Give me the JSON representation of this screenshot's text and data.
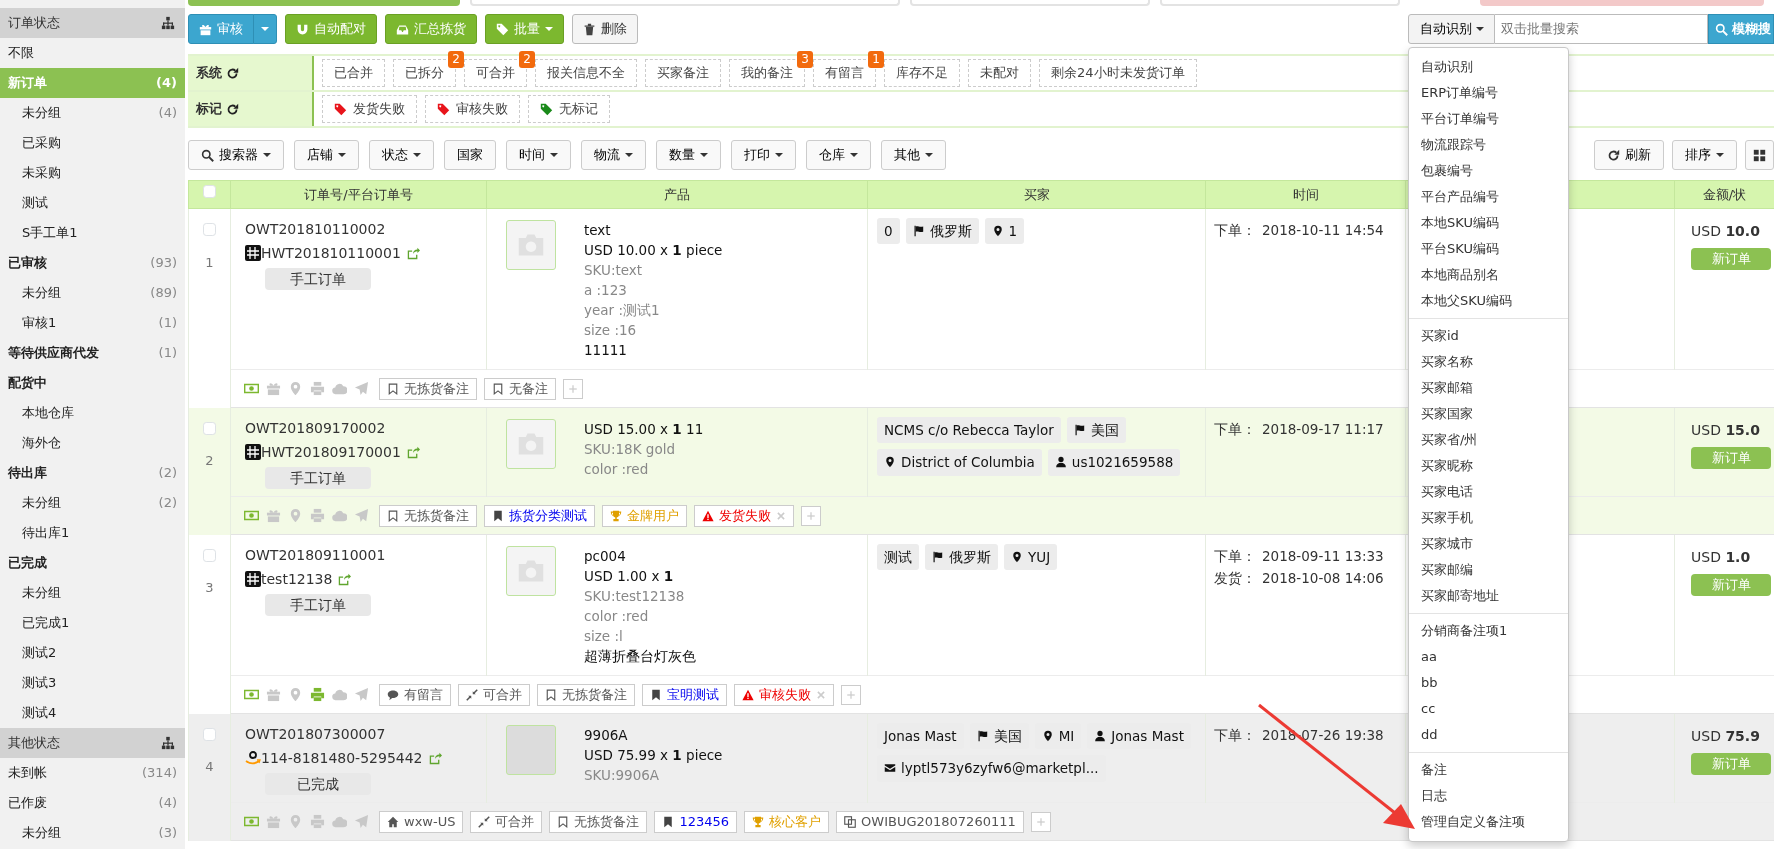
{
  "sidebar": {
    "sections": [
      {
        "title": "订单状态",
        "items": [
          {
            "label": "不限",
            "bold": false,
            "selected": false
          },
          {
            "label": "新订单",
            "count": "(4)",
            "bold": true,
            "selected": true,
            "children": [
              {
                "label": "未分组",
                "count": "(4)",
                "selected": false
              },
              {
                "label": "已采购",
                "selected": false
              },
              {
                "label": "未采购",
                "selected": false
              },
              {
                "label": "测试",
                "selected": false
              },
              {
                "label": "S手工单1",
                "selected": false
              }
            ]
          },
          {
            "label": "已审核",
            "count": "(93)",
            "bold": true,
            "selected": false,
            "children": [
              {
                "label": "未分组",
                "count": "(89)",
                "selected": false
              },
              {
                "label": "审核1",
                "count": "(1)",
                "selected": false
              }
            ]
          },
          {
            "label": "等待供应商代发",
            "count": "(1)",
            "bold": true,
            "selected": false
          },
          {
            "label": "配货中",
            "bold": true,
            "selected": false,
            "children": [
              {
                "label": "本地仓库",
                "selected": false
              },
              {
                "label": "海外仓",
                "selected": false
              }
            ]
          },
          {
            "label": "待出库",
            "count": "(2)",
            "bold": true,
            "selected": false,
            "children": [
              {
                "label": "未分组",
                "count": "(2)",
                "selected": false
              },
              {
                "label": "待出库1",
                "selected": false
              }
            ]
          },
          {
            "label": "已完成",
            "bold": true,
            "selected": false,
            "children": [
              {
                "label": "未分组",
                "selected": false
              },
              {
                "label": "已完成1",
                "selected": false
              },
              {
                "label": "测试2",
                "selected": false
              },
              {
                "label": "测试3",
                "selected": false
              },
              {
                "label": "测试4",
                "selected": false
              }
            ]
          }
        ]
      },
      {
        "title": "其他状态",
        "items": [
          {
            "label": "未到帐",
            "count": "(314)",
            "bold": false,
            "selected": false
          },
          {
            "label": "已作废",
            "count": "(4)",
            "bold": false,
            "selected": false,
            "children": [
              {
                "label": "未分组",
                "count": "(3)",
                "selected": false
              }
            ]
          }
        ]
      }
    ]
  },
  "toolbar": {
    "buttons": [
      {
        "label": "审核",
        "kind": "split"
      },
      {
        "label": "自动配对",
        "kind": "action"
      },
      {
        "label": "汇总拣货",
        "kind": "action"
      },
      {
        "label": "批量",
        "kind": "menu"
      },
      {
        "label": "删除",
        "kind": "plain"
      }
    ],
    "search": {
      "mode": "自动识别",
      "placeholder": "双击批量搜索",
      "button": "模糊搜"
    }
  },
  "filters": {
    "system": {
      "label": "系统",
      "chips": [
        {
          "label": "已合并"
        },
        {
          "label": "已拆分",
          "badge": "2"
        },
        {
          "label": "可合并",
          "badge": "2"
        },
        {
          "label": "报关信息不全"
        },
        {
          "label": "买家备注"
        },
        {
          "label": "我的备注",
          "badge": "3"
        },
        {
          "label": "有留言",
          "badge": "1"
        },
        {
          "label": "库存不足"
        },
        {
          "label": "未配对"
        },
        {
          "label": "剩余24小时未发货订单"
        }
      ]
    },
    "marks": {
      "label": "标记",
      "chips": [
        {
          "label": "发货失败",
          "color": "#e8141b"
        },
        {
          "label": "审核失败",
          "color": "#e8141b"
        },
        {
          "label": "无标记",
          "color": "#1a8a1a"
        }
      ]
    },
    "buttons": [
      {
        "label": "搜索器",
        "caret": true
      },
      {
        "label": "店铺",
        "caret": true
      },
      {
        "label": "状态",
        "caret": true
      },
      {
        "label": "国家",
        "caret": false
      },
      {
        "label": "时间",
        "caret": true
      },
      {
        "label": "物流",
        "caret": true
      },
      {
        "label": "数量",
        "caret": true
      },
      {
        "label": "打印",
        "caret": true
      },
      {
        "label": "仓库",
        "caret": true
      },
      {
        "label": "其他",
        "caret": true
      }
    ],
    "right_buttons": [
      {
        "label": "刷新",
        "caret": false
      },
      {
        "label": "排序",
        "caret": true
      },
      {
        "caret": false
      }
    ]
  },
  "search_menu": {
    "groups": [
      [
        "自动识别",
        "ERP订单编号",
        "平台订单编号",
        "物流跟踪号",
        "包裹编号",
        "平台产品编号",
        "本地SKU编码",
        "平台SKU编码",
        "本地商品别名",
        "本地父SKU编码"
      ],
      [
        "买家id",
        "买家名称",
        "买家邮箱",
        "买家国家",
        "买家省/州",
        "买家昵称",
        "买家电话",
        "买家手机",
        "买家城市",
        "买家邮编",
        "买家邮寄地址"
      ],
      [
        "分销商备注项1",
        "aa",
        "bb",
        "cc",
        "dd"
      ],
      [
        "备注",
        "日志",
        "管理自定义备注项"
      ]
    ]
  },
  "annotation_arrow": true,
  "table": {
    "select_all_checked": false,
    "columns": [
      "订单号/平台订单号",
      "产品",
      "买家",
      "时间",
      "",
      "金额/状"
    ],
    "rows": [
      {
        "index": "1",
        "checked": false,
        "highlighted": false,
        "dimmed": false,
        "order_no": "OWT201810110002",
        "platform_order": {
          "kind": "erp",
          "number": "HWT201810110001"
        },
        "order_type": "手工订单",
        "product": {
          "image": {
            "kind": "placeholder"
          },
          "lines": [
            {
              "kind": "title",
              "text": "text"
            },
            {
              "kind": "price",
              "text": "USD 10.00 x **1** piece"
            },
            {
              "kind": "attr",
              "text": "SKU:text"
            },
            {
              "kind": "attr",
              "text": "a :123"
            },
            {
              "kind": "attr",
              "text": "year :测试1"
            },
            {
              "kind": "attr",
              "text": "size :16"
            },
            {
              "kind": "title",
              "text": "11111"
            }
          ]
        },
        "buyer": [
          {
            "kind": "name",
            "text": "0"
          },
          {
            "kind": "country",
            "text": "俄罗斯"
          },
          {
            "kind": "region",
            "text": "1"
          }
        ],
        "time": [
          {
            "label": "下单：",
            "value": "2018-10-11 14:54"
          }
        ],
        "amount": "USD **10.0**",
        "status": "新订单",
        "actions": [
          {
            "kind": "money",
            "active": true
          },
          {
            "kind": "gift",
            "active": false
          },
          {
            "kind": "pin",
            "active": false
          },
          {
            "kind": "print",
            "active": false
          },
          {
            "kind": "cloud",
            "active": false
          },
          {
            "kind": "plane",
            "active": false
          }
        ],
        "notes": [
          {
            "kind": "empty",
            "text": "无拣货备注",
            "removable": false
          },
          {
            "kind": "empty",
            "text": "无备注",
            "removable": false
          }
        ]
      },
      {
        "index": "2",
        "checked": false,
        "highlighted": true,
        "dimmed": false,
        "order_no": "OWT201809170002",
        "platform_order": {
          "kind": "erp",
          "number": "HWT201809170001"
        },
        "order_type": "手工订单",
        "product": {
          "image": {
            "kind": "placeholder"
          },
          "lines": [
            {
              "kind": "price",
              "text": "USD 15.00 x **1** 11"
            },
            {
              "kind": "attr",
              "text": "SKU:18K gold"
            },
            {
              "kind": "attr",
              "text": "color :red"
            }
          ]
        },
        "buyer": [
          {
            "kind": "name",
            "text": "NCMS c/o Rebecca Taylor"
          },
          {
            "kind": "country",
            "text": "美国"
          },
          {
            "kind": "region",
            "text": "District of Columbia"
          },
          {
            "kind": "user",
            "text": "us1021659588"
          }
        ],
        "time": [
          {
            "label": "下单：",
            "value": "2018-09-17 11:17"
          }
        ],
        "amount": "USD **15.0**",
        "status": "新订单",
        "actions": [
          {
            "kind": "money",
            "active": true
          },
          {
            "kind": "gift",
            "active": false
          },
          {
            "kind": "pin",
            "active": false
          },
          {
            "kind": "print",
            "active": false
          },
          {
            "kind": "cloud",
            "active": false
          },
          {
            "kind": "plane",
            "active": false
          }
        ],
        "notes": [
          {
            "kind": "empty",
            "text": "无拣货备注",
            "removable": false
          },
          {
            "kind": "category",
            "text": "拣货分类测试",
            "removable": false
          },
          {
            "kind": "vip",
            "text": "金牌用户",
            "removable": false
          },
          {
            "kind": "alert",
            "text": "发货失败",
            "removable": true
          }
        ]
      },
      {
        "index": "3",
        "checked": false,
        "highlighted": false,
        "dimmed": false,
        "order_no": "OWT201809110001",
        "platform_order": {
          "kind": "erp",
          "number": "test12138"
        },
        "order_type": "手工订单",
        "product": {
          "image": {
            "kind": "placeholder"
          },
          "lines": [
            {
              "kind": "title",
              "text": "pc004"
            },
            {
              "kind": "price",
              "text": "USD 1.00 x **1**"
            },
            {
              "kind": "attr",
              "text": "SKU:test12138"
            },
            {
              "kind": "attr",
              "text": "color :red"
            },
            {
              "kind": "attr",
              "text": "size :l"
            },
            {
              "kind": "title",
              "text": "超薄折叠台灯灰色"
            }
          ]
        },
        "buyer": [
          {
            "kind": "name",
            "text": "测试"
          },
          {
            "kind": "country",
            "text": "俄罗斯"
          },
          {
            "kind": "region",
            "text": "YUJ"
          }
        ],
        "time": [
          {
            "label": "下单：",
            "value": "2018-09-11 13:33"
          },
          {
            "label": "发货：",
            "value": "2018-10-08 14:06"
          }
        ],
        "amount": "USD **1.0**",
        "status": "新订单",
        "actions": [
          {
            "kind": "money",
            "active": true
          },
          {
            "kind": "gift",
            "active": false
          },
          {
            "kind": "pin",
            "active": false
          },
          {
            "kind": "print",
            "active": true
          },
          {
            "kind": "cloud",
            "active": false
          },
          {
            "kind": "plane",
            "active": false
          }
        ],
        "notes": [
          {
            "kind": "message",
            "text": "有留言",
            "removable": false
          },
          {
            "kind": "merge",
            "text": "可合并",
            "removable": false
          },
          {
            "kind": "empty",
            "text": "无拣货备注",
            "removable": false
          },
          {
            "kind": "category",
            "text": "宝明测试",
            "removable": false
          },
          {
            "kind": "alert",
            "text": "审核失败",
            "removable": true
          }
        ]
      },
      {
        "index": "4",
        "checked": false,
        "highlighted": false,
        "dimmed": true,
        "order_no": "OWT201807300007",
        "platform_order": {
          "kind": "amazon",
          "number": "114-8181480-5295442"
        },
        "order_type": "已完成",
        "product": {
          "image": {
            "kind": "photo"
          },
          "lines": [
            {
              "kind": "title",
              "text": "9906A"
            },
            {
              "kind": "price",
              "text": "USD 75.99 x **1** piece"
            },
            {
              "kind": "attr",
              "text": "SKU:9906A"
            }
          ]
        },
        "buyer": [
          {
            "kind": "name",
            "text": "Jonas Mast"
          },
          {
            "kind": "country",
            "text": "美国"
          },
          {
            "kind": "region",
            "text": "MI"
          },
          {
            "kind": "user",
            "text": "Jonas Mast"
          },
          {
            "kind": "email",
            "text": "lyptl573y6zyfw6@marketpl..."
          }
        ],
        "time": [
          {
            "label": "下单：",
            "value": "2018-07-26 19:38"
          }
        ],
        "amount": "USD **75.9**",
        "status": "新订单",
        "actions": [
          {
            "kind": "money",
            "active": true
          },
          {
            "kind": "gift",
            "active": false
          },
          {
            "kind": "pin",
            "active": false
          },
          {
            "kind": "print",
            "active": false
          },
          {
            "kind": "cloud",
            "active": false
          },
          {
            "kind": "plane",
            "active": false
          }
        ],
        "notes": [
          {
            "kind": "store",
            "text": "wxw-US",
            "removable": false
          },
          {
            "kind": "merge",
            "text": "可合并",
            "removable": false
          },
          {
            "kind": "empty",
            "text": "无拣货备注",
            "removable": false
          },
          {
            "kind": "category",
            "text": "123456",
            "removable": false
          },
          {
            "kind": "vip",
            "text": "核心客户",
            "removable": false
          },
          {
            "kind": "link",
            "text": "OWIBUG201807260111",
            "removable": false
          }
        ]
      }
    ]
  }
}
